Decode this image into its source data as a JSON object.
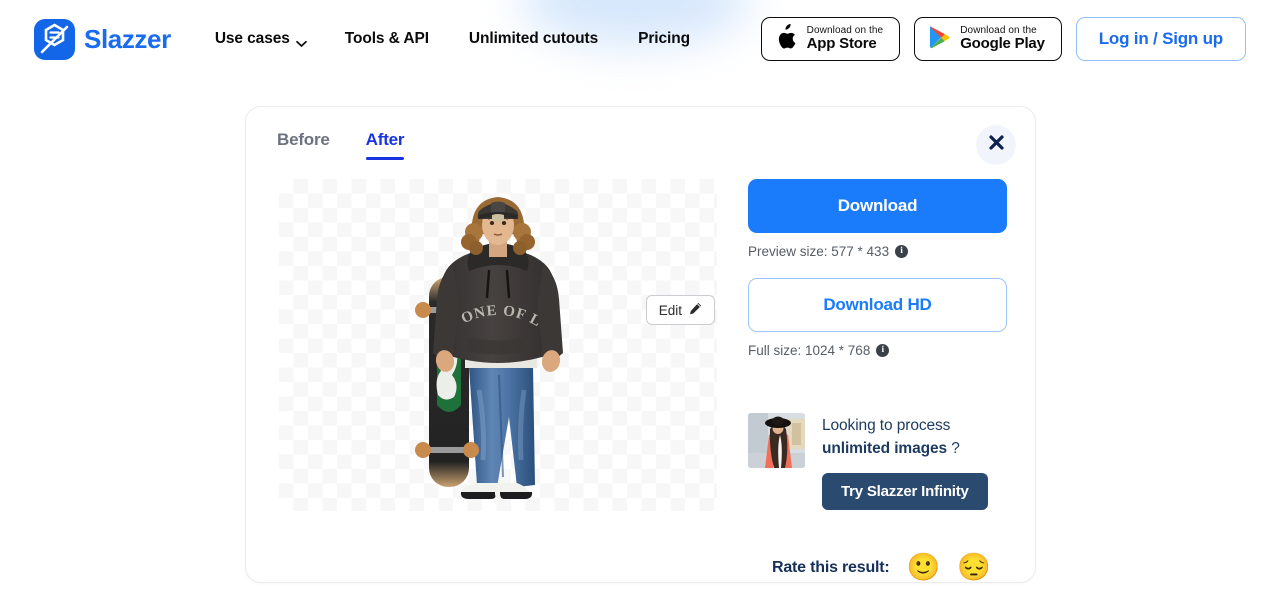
{
  "header": {
    "brand_name": "Slazzer",
    "logo_icon": "slazzer-logo-icon",
    "nav": [
      {
        "label": "Use cases",
        "has_caret": true
      },
      {
        "label": "Tools & API",
        "has_caret": false
      },
      {
        "label": "Unlimited cutouts",
        "has_caret": false
      },
      {
        "label": "Pricing",
        "has_caret": false
      }
    ],
    "app_store": {
      "small": "Download on the",
      "big": "App Store",
      "icon": "apple-icon"
    },
    "google_play": {
      "small": "Download on the",
      "big": "Google Play",
      "icon": "google-play-icon"
    },
    "login": "Log in / Sign up"
  },
  "card": {
    "tabs": [
      {
        "label": "Before",
        "active": false
      },
      {
        "label": "After",
        "active": true
      }
    ],
    "close_icon": "close-icon",
    "edit_button": {
      "label": "Edit",
      "icon": "pencil-icon"
    },
    "preview_alt": "cutout of person in dark hoodie holding a skateboard on transparent background"
  },
  "panel": {
    "download_label": "Download",
    "preview_size": "Preview size: 577 * 433",
    "preview_info_icon": "info-icon",
    "download_hd_label": "Download HD",
    "full_size": "Full size: 1024 * 768",
    "full_info_icon": "info-icon"
  },
  "promo": {
    "line1": "Looking to process",
    "line2_bold": "unlimited images",
    "line2_tail": " ?",
    "button_label": "Try Slazzer Infinity",
    "thumb_alt": "woman in coral blazer and black hat"
  },
  "rating": {
    "label": "Rate this result:",
    "emojis": [
      {
        "name": "slightly-smiling-face",
        "glyph": "🙂"
      },
      {
        "name": "pensive-face",
        "glyph": "😔"
      }
    ]
  },
  "colors": {
    "brand_blue": "#1a6bf0",
    "primary_button": "#1a7bfb",
    "tab_active": "#1a33e0",
    "promo_button": "#2b4a6f"
  }
}
